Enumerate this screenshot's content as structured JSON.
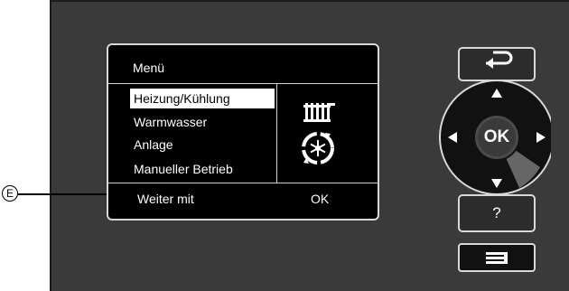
{
  "display": {
    "title": "Menü",
    "items": [
      {
        "label": "Heizung/Kühlung",
        "selected": true
      },
      {
        "label": "Warmwasser",
        "selected": false
      },
      {
        "label": "Anlage",
        "selected": false
      },
      {
        "label": "Manueller Betrieb",
        "selected": false
      }
    ],
    "footer_left": "Weiter mit",
    "footer_right": "OK",
    "icons": [
      "radiator-icon",
      "cooling-snowflake-icon"
    ]
  },
  "controls": {
    "back_icon": "back-arrow-icon",
    "ok_label": "OK",
    "help_label": "?",
    "menu_icon": "menu-lines-icon"
  },
  "callout": {
    "label": "E"
  },
  "colors": {
    "panel": "#3a3a3a",
    "display": "#000000",
    "highlight": "#ffffff"
  }
}
